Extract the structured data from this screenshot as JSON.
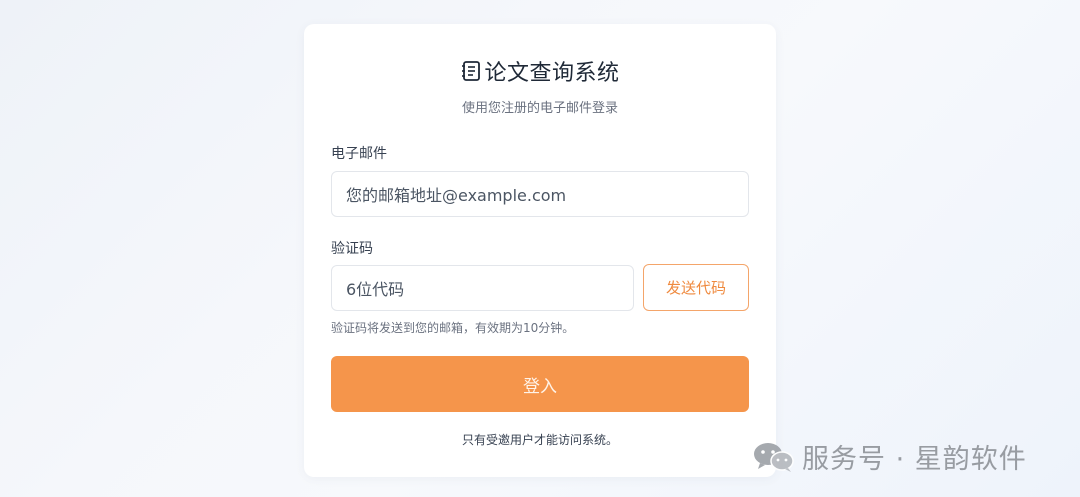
{
  "app": {
    "title": "论文查询系统",
    "subtitle": "使用您注册的电子邮件登录"
  },
  "form": {
    "email_label": "电子邮件",
    "email_placeholder": "您的邮箱地址@example.com",
    "code_label": "验证码",
    "code_placeholder": "6位代码",
    "send_code_label": "发送代码",
    "hint": "验证码将发送到您的邮箱，有效期为10分钟。",
    "login_label": "登入",
    "footnote": "只有受邀用户才能访问系统。"
  },
  "icons": {
    "title_icon": "notebook-icon",
    "watermark_icon": "wechat-icon"
  },
  "watermark": {
    "text": "服务号 · 星韵软件"
  },
  "colors": {
    "accent": "#f5954b",
    "accent_border": "#f4a56a",
    "accent_text": "#ef8a3f"
  }
}
